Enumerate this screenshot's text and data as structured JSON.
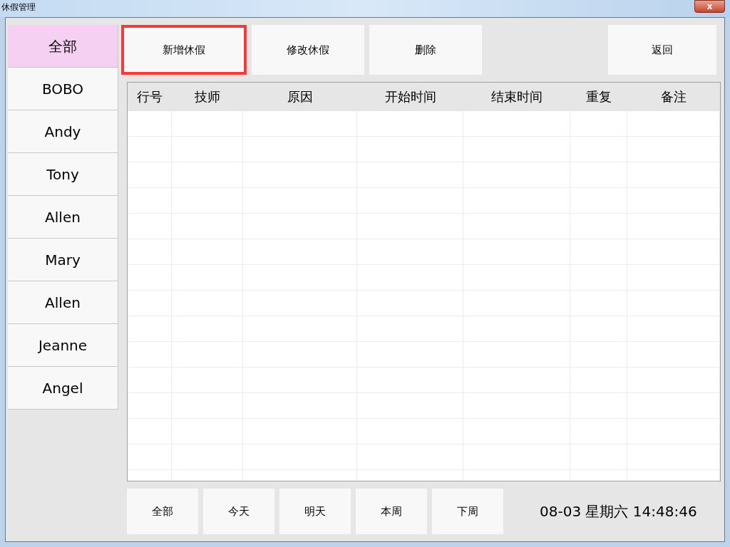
{
  "window": {
    "title": "休假管理",
    "close_label": "x"
  },
  "sidebar": {
    "items": [
      {
        "label": "全部",
        "selected": true
      },
      {
        "label": "BOBO",
        "selected": false
      },
      {
        "label": "Andy",
        "selected": false
      },
      {
        "label": "Tony",
        "selected": false
      },
      {
        "label": "Allen",
        "selected": false
      },
      {
        "label": "Mary",
        "selected": false
      },
      {
        "label": "Allen",
        "selected": false
      },
      {
        "label": "Jeanne",
        "selected": false
      },
      {
        "label": "Angel",
        "selected": false
      }
    ]
  },
  "toolbar": {
    "buttons": [
      {
        "label": "新增休假",
        "highlighted": true
      },
      {
        "label": "修改休假",
        "highlighted": false
      },
      {
        "label": "删除",
        "highlighted": false
      }
    ],
    "back_button": "返回"
  },
  "table": {
    "columns": [
      "行号",
      "技师",
      "原因",
      "开始时间",
      "结束时间",
      "重复",
      "备注"
    ]
  },
  "filters": {
    "buttons": [
      "全部",
      "今天",
      "明天",
      "本周",
      "下周"
    ]
  },
  "datetime": "08-03 星期六 14:48:46"
}
